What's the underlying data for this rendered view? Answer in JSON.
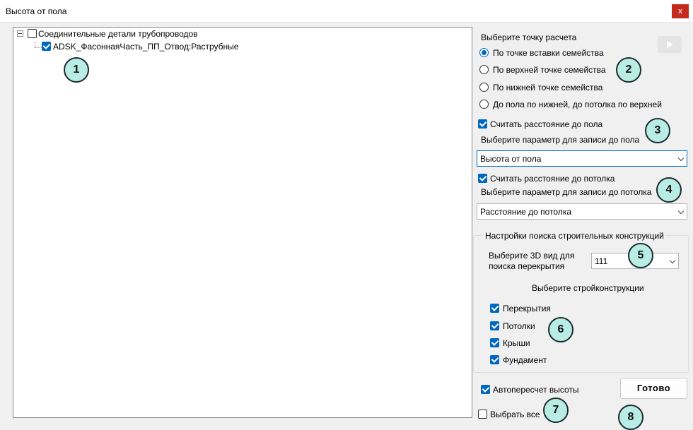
{
  "window": {
    "title": "Высота от пола",
    "close_glyph": "x"
  },
  "tree": {
    "root_label": "Соединительные детали трубопроводов",
    "child_label": "ADSK_ФасоннаяЧасть_ПП_Отвод:Раструбные"
  },
  "calc_point": {
    "heading": "Выберите точку расчета",
    "options": [
      "По точке вставки семейства",
      "По верхней точке семейства",
      "По нижней точке семейства",
      "До пола по нижней, до потолка по верхней"
    ],
    "selected_index": 0
  },
  "floor": {
    "checkbox_label": "Считать расстояние до пола",
    "param_heading": "Выберите параметр для записи до пола",
    "param_value": "Высота от пола"
  },
  "ceiling": {
    "checkbox_label": "Считать расстояние до потолка",
    "param_heading": "Выберите параметр для записи до потолка",
    "param_value": "Расстояние до потолка"
  },
  "search": {
    "group_title": "Настройки поиска строительных конструкций",
    "view_label_line1": "Выберите 3D вид для",
    "view_label_line2": "поиска перекрытия",
    "view_value": "111",
    "structures_heading": "Выберите стройконструкции",
    "structures": [
      "Перекрытия",
      "Потолки",
      "Крыши",
      "Фундамент"
    ]
  },
  "bottom": {
    "auto_recalc_label": "Автопересчет высоты",
    "select_all_label": "Выбрать все",
    "done_label": "Готово"
  },
  "badges": [
    "1",
    "2",
    "3",
    "4",
    "5",
    "6",
    "7",
    "8"
  ],
  "colors": {
    "accent": "#0067c0",
    "badge_fill": "#b8ece4",
    "close_red": "#c42b1c"
  },
  "icons": {
    "play": "play-icon",
    "expander": "tree-collapse-icon",
    "dropdown": "chevron-down-icon"
  }
}
